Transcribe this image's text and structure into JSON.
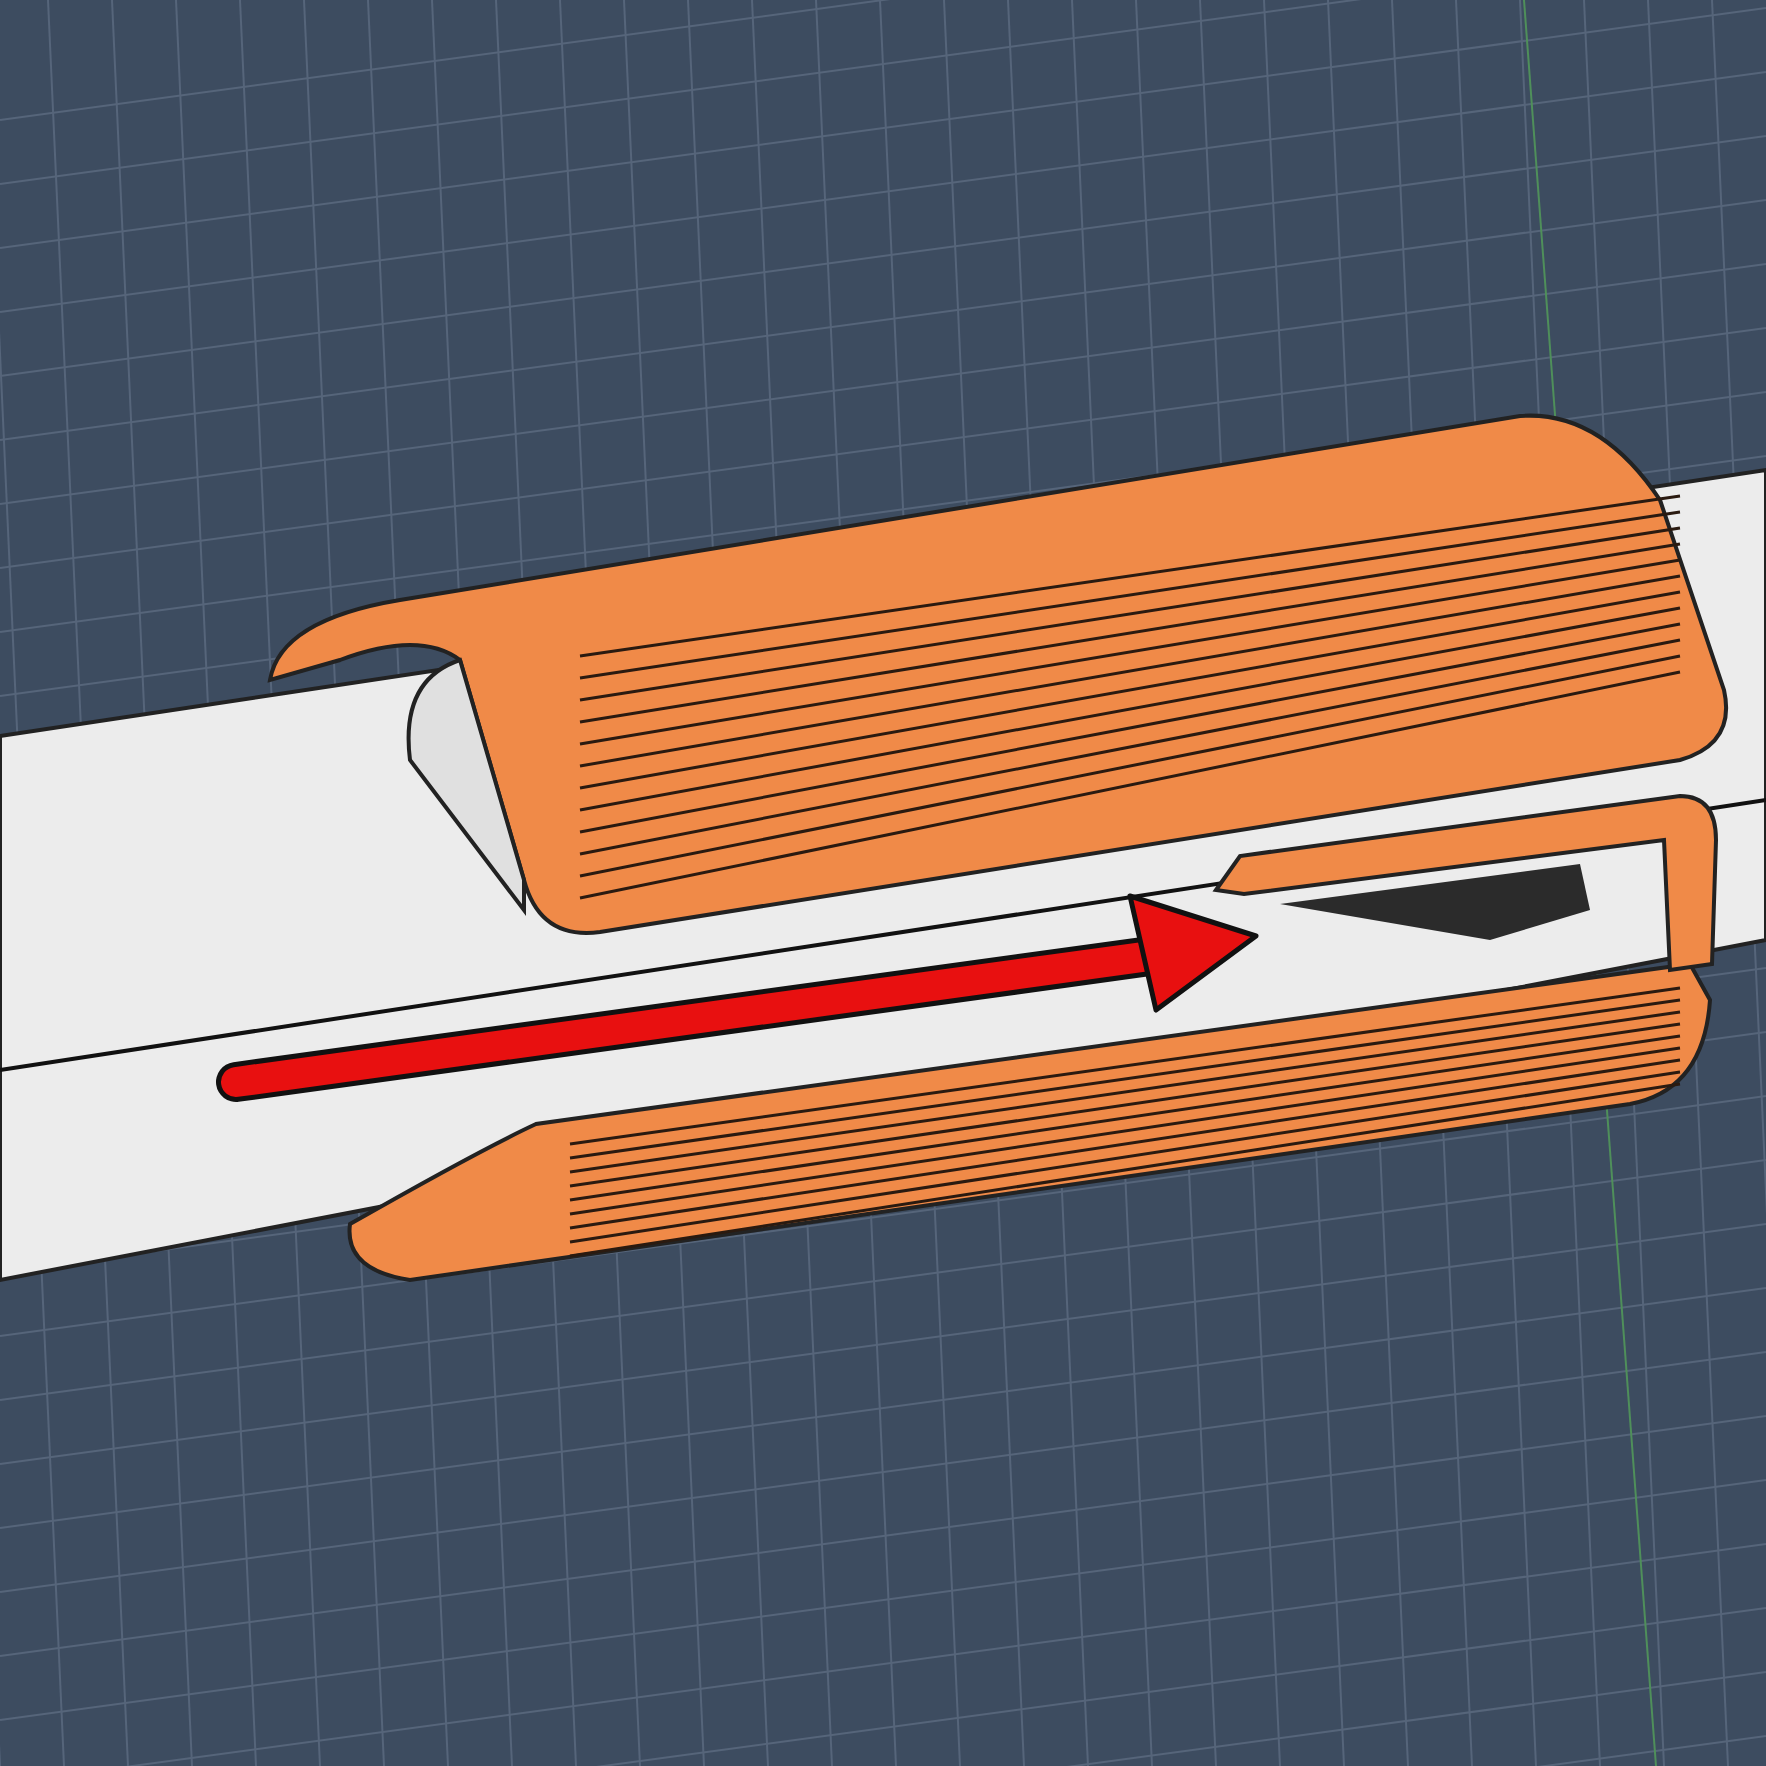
{
  "viewport": {
    "parts": [
      {
        "kind": "pipe"
      },
      {
        "kind": "sleeve"
      }
    ],
    "annotations": [
      {
        "kind": "arrow"
      }
    ]
  }
}
